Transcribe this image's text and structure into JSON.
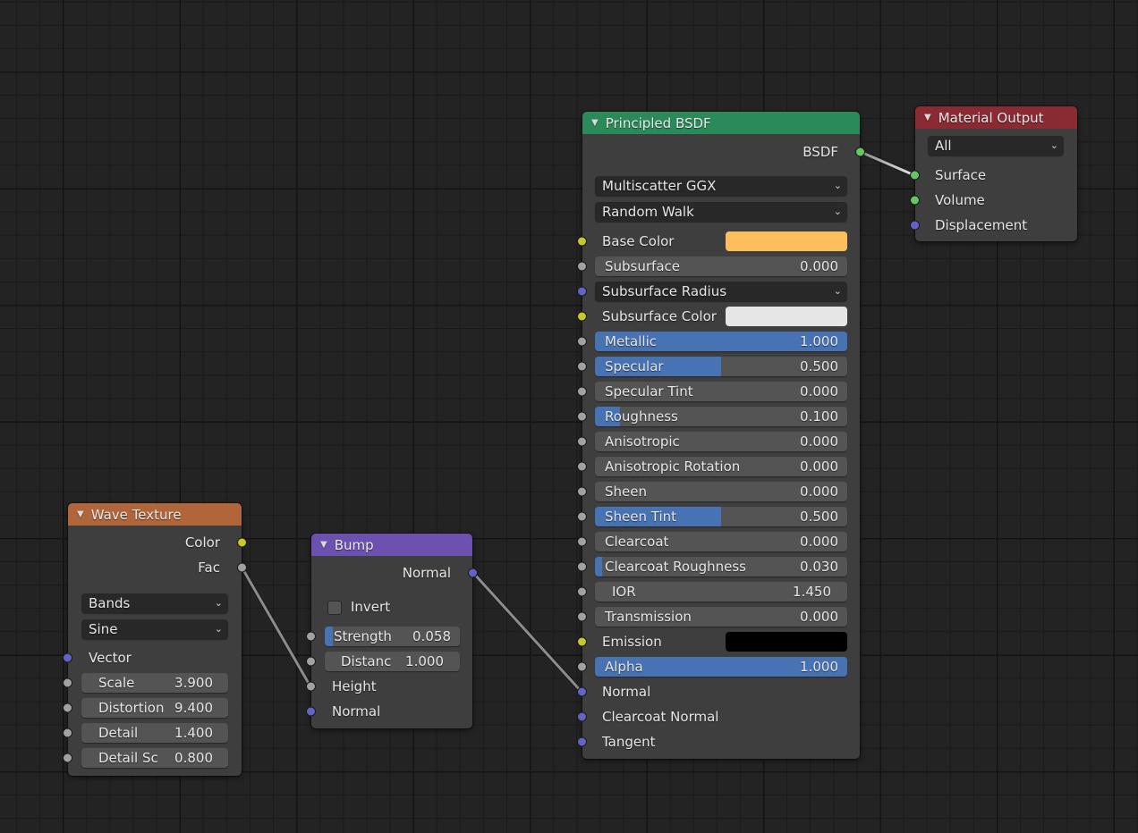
{
  "colors": {
    "header_wave": "#b0653a",
    "header_bump": "#6c51b0",
    "header_principled": "#2a8a5a",
    "header_output": "#8a2a33",
    "slider_fill": "#4772b3",
    "base_color": "#fcbf5c",
    "subsurface_color": "#e6e6e6",
    "emission_color": "#000000"
  },
  "wave_texture": {
    "title": "Wave Texture",
    "outputs": [
      "Color",
      "Fac"
    ],
    "wave_type": "Bands",
    "wave_profile": "Sine",
    "vector_label": "Vector",
    "fields": [
      {
        "label": "Scale",
        "value": "3.900"
      },
      {
        "label": "Distortion",
        "value": "9.400"
      },
      {
        "label": "Detail",
        "value": "1.400"
      },
      {
        "label": "Detail Sc",
        "value": "0.800"
      }
    ]
  },
  "bump": {
    "title": "Bump",
    "output": "Normal",
    "invert_label": "Invert",
    "invert_checked": false,
    "strength": {
      "label": "Strength",
      "value": "0.058",
      "fraction": 0.058
    },
    "distance": {
      "label": "Distanc",
      "value": "1.000"
    },
    "inputs": [
      "Height",
      "Normal"
    ]
  },
  "principled": {
    "title": "Principled BSDF",
    "output": "BSDF",
    "distribution": "Multiscatter GGX",
    "subsurface_method": "Random Walk",
    "base_color_label": "Base Color",
    "subsurface_radius_label": "Subsurface Radius",
    "subsurface_color_label": "Subsurface Color",
    "emission_label": "Emission",
    "sliders": {
      "subsurface": {
        "label": "Subsurface",
        "value": "0.000",
        "fraction": 0.0
      },
      "metallic": {
        "label": "Metallic",
        "value": "1.000",
        "fraction": 1.0
      },
      "specular": {
        "label": "Specular",
        "value": "0.500",
        "fraction": 0.5
      },
      "specular_tint": {
        "label": "Specular Tint",
        "value": "0.000",
        "fraction": 0.0
      },
      "roughness": {
        "label": "Roughness",
        "value": "0.100",
        "fraction": 0.1
      },
      "anisotropic": {
        "label": "Anisotropic",
        "value": "0.000",
        "fraction": 0.0
      },
      "anisotropic_rotation": {
        "label": "Anisotropic Rotation",
        "value": "0.000",
        "fraction": 0.0
      },
      "sheen": {
        "label": "Sheen",
        "value": "0.000",
        "fraction": 0.0
      },
      "sheen_tint": {
        "label": "Sheen Tint",
        "value": "0.500",
        "fraction": 0.5
      },
      "clearcoat": {
        "label": "Clearcoat",
        "value": "0.000",
        "fraction": 0.0
      },
      "clearcoat_roughness": {
        "label": "Clearcoat Roughness",
        "value": "0.030",
        "fraction": 0.03
      },
      "ior": {
        "label": "IOR",
        "value": "1.450"
      },
      "transmission": {
        "label": "Transmission",
        "value": "0.000",
        "fraction": 0.0
      },
      "alpha": {
        "label": "Alpha",
        "value": "1.000",
        "fraction": 1.0
      }
    },
    "vector_inputs": [
      "Normal",
      "Clearcoat Normal",
      "Tangent"
    ]
  },
  "material_output": {
    "title": "Material Output",
    "target": "All",
    "inputs": [
      "Surface",
      "Volume",
      "Displacement"
    ]
  },
  "icons": {
    "collapse": "▼",
    "chevron": "⌄"
  }
}
